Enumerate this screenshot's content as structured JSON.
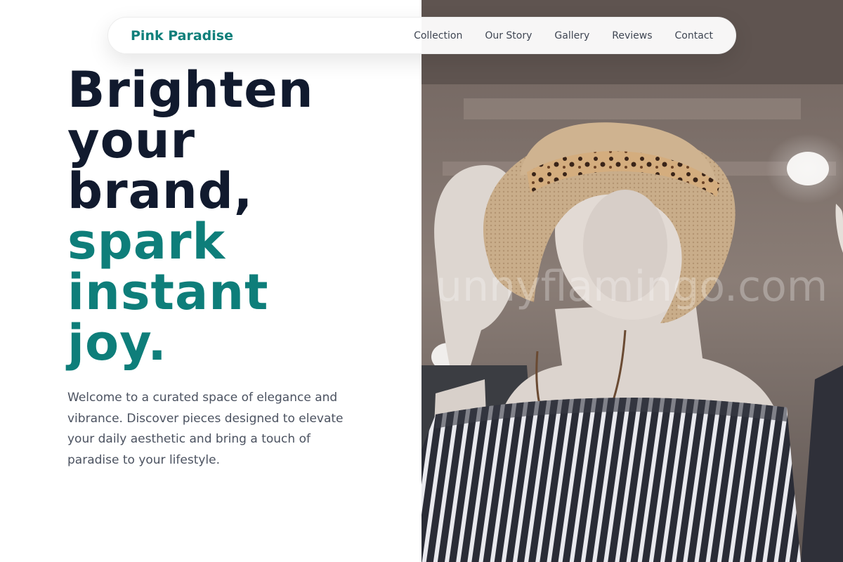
{
  "nav": {
    "brand": "Pink Paradise",
    "links": [
      "Collection",
      "Our Story",
      "Gallery",
      "Reviews",
      "Contact"
    ]
  },
  "hero": {
    "headline_dark": [
      "Brighten",
      "your",
      "brand,"
    ],
    "headline_accent": [
      "spark",
      "instant",
      "joy."
    ],
    "intro": "Welcome to a curated space of elegance and vibrance. Discover pieces designed to elevate your daily aesthetic and bring a touch of paradise to your lifestyle.",
    "image_watermark": "unnyflamingo.com"
  },
  "colors": {
    "brand_teal": "#0e7e7a",
    "headline_dark": "#111a2e",
    "body_text": "#4b5260"
  },
  "icons": []
}
